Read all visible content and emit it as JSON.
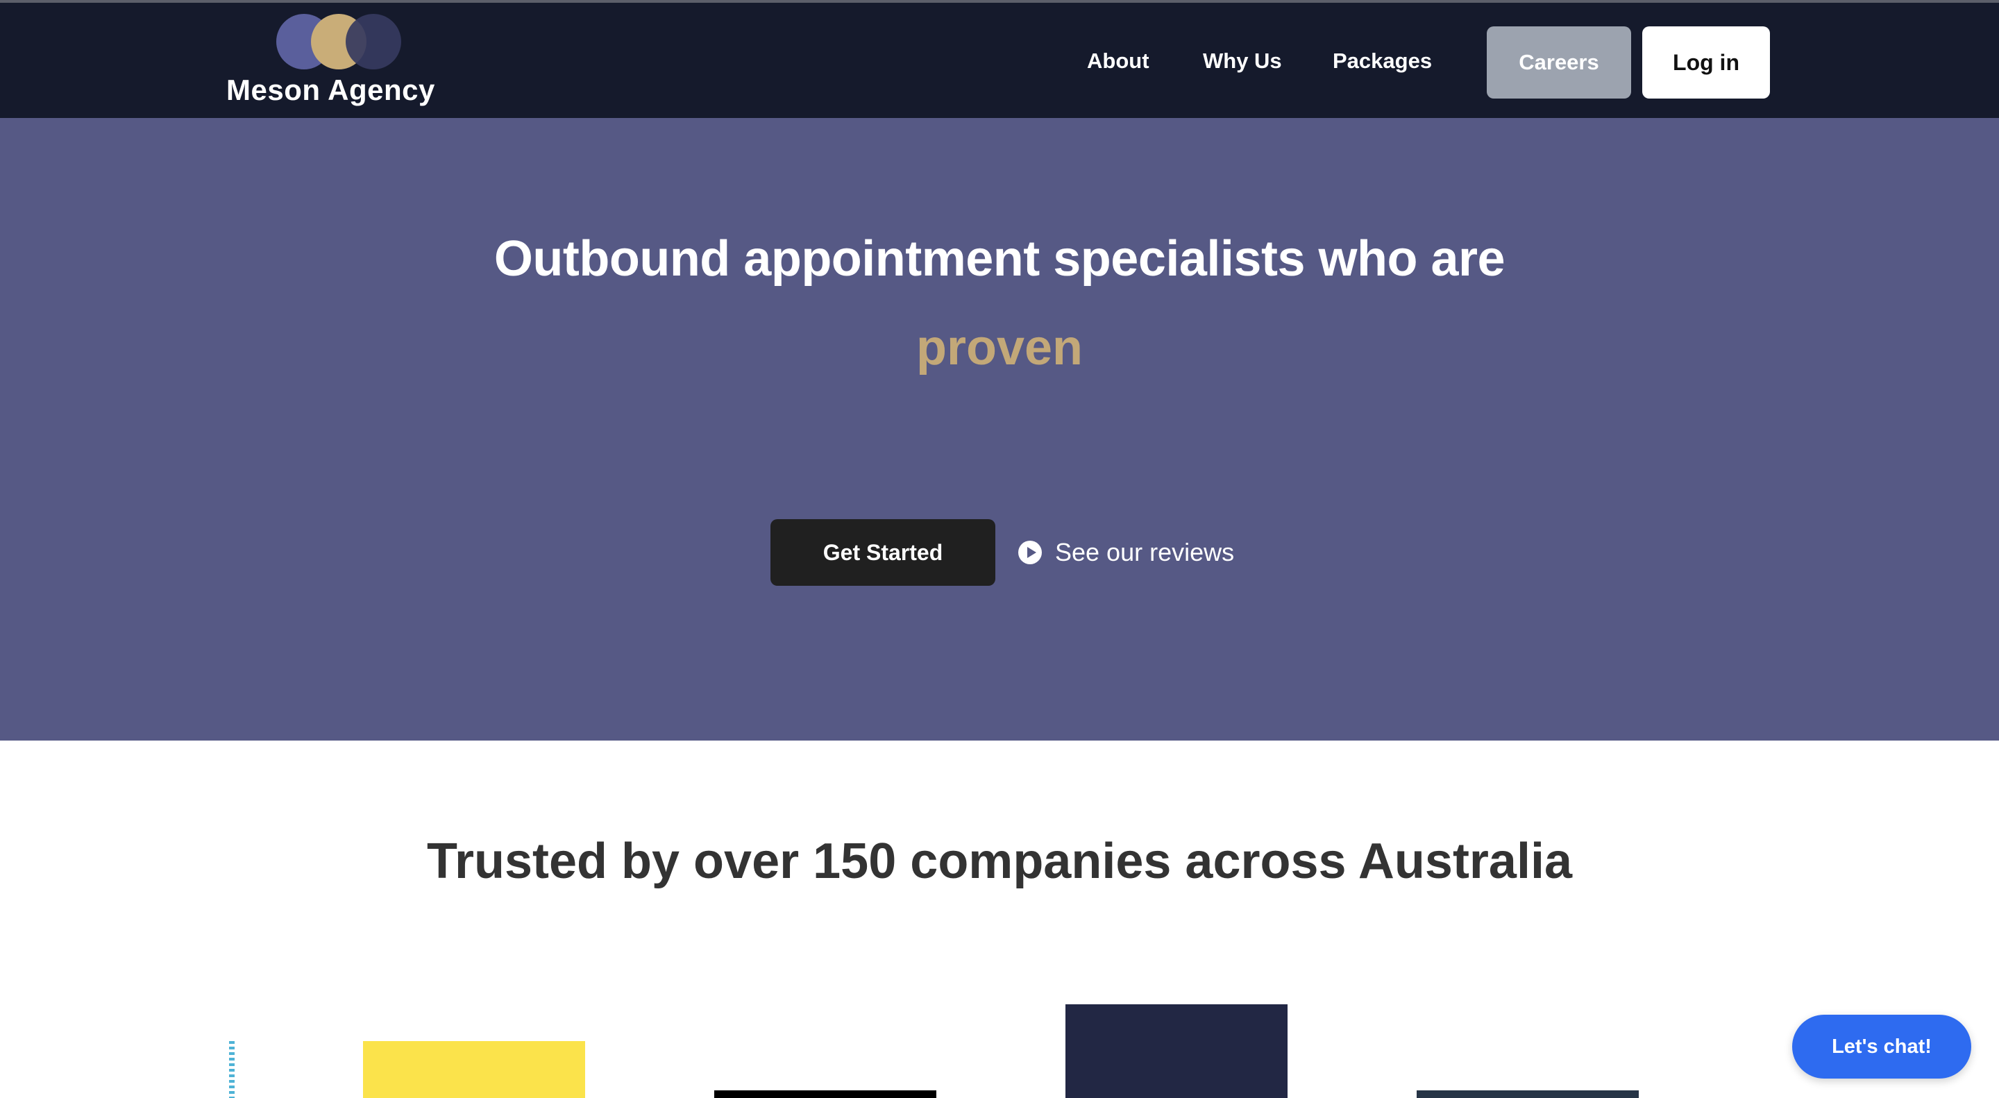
{
  "brand": {
    "name": "Meson Agency",
    "colors": {
      "navbar": "#151a2c",
      "hero_bg": "#565985",
      "accent_gold": "#c3a878",
      "chat_blue": "#2e6bf0"
    }
  },
  "nav": {
    "links": [
      {
        "label": "About"
      },
      {
        "label": "Why Us"
      },
      {
        "label": "Packages"
      }
    ],
    "careers_label": "Careers",
    "login_label": "Log in"
  },
  "hero": {
    "headline": "Outbound appointment specialists who are",
    "rotating_word": "proven",
    "cta_label": "Get Started",
    "reviews_label": "See our reviews",
    "reviews_icon": "play-circle-icon"
  },
  "trusted": {
    "title": "Trusted by over 150 companies across Australia"
  },
  "chat": {
    "label": "Let's chat!"
  }
}
